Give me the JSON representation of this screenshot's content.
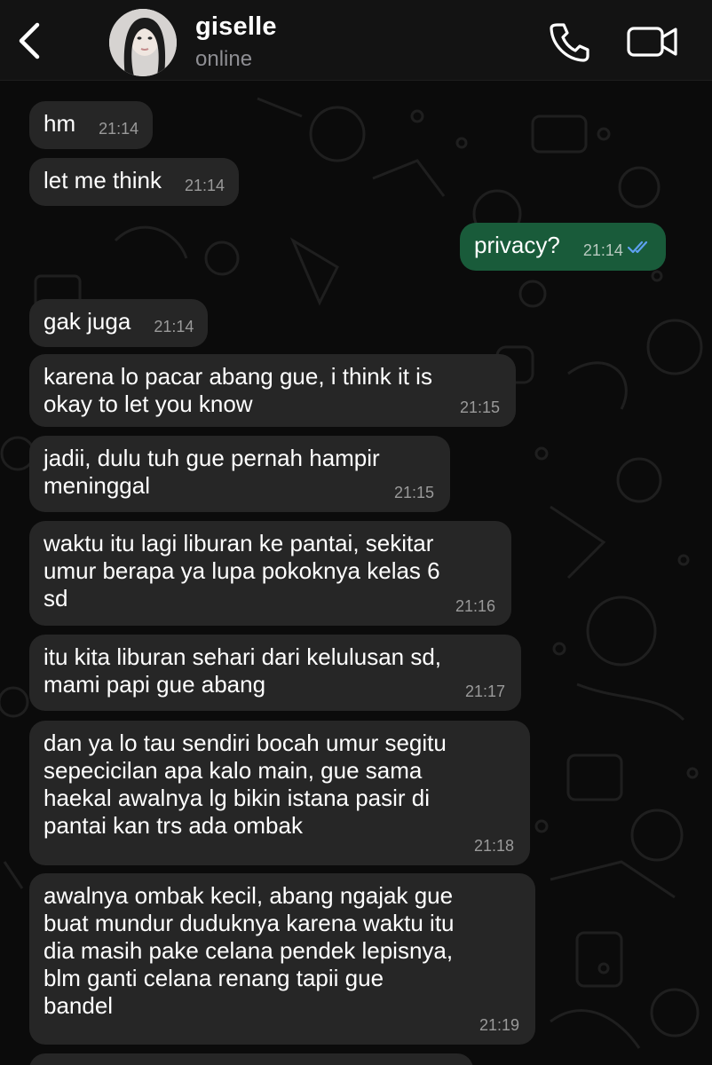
{
  "header": {
    "contact_name": "giselle",
    "status": "online",
    "back_icon": "chevron-left-icon",
    "call_icon": "phone-icon",
    "video_icon": "video-camera-icon"
  },
  "colors": {
    "incoming_bubble": "#262626",
    "outgoing_bubble": "#195b3a",
    "background": "#0b0b0b",
    "read_ticks": "#5ea1f0"
  },
  "messages": [
    {
      "direction": "incoming",
      "text": "hm",
      "time": "21:14"
    },
    {
      "direction": "incoming",
      "text": "let me think",
      "time": "21:14"
    },
    {
      "direction": "outgoing",
      "text": "privacy?",
      "time": "21:14",
      "status": "read"
    },
    {
      "direction": "incoming",
      "text": "gak juga",
      "time": "21:14"
    },
    {
      "direction": "incoming",
      "text": "karena lo pacar abang gue, i think it is\nokay to let you know",
      "time": "21:15"
    },
    {
      "direction": "incoming",
      "text": "jadii, dulu tuh gue pernah hampir\nmeninggal",
      "time": "21:15"
    },
    {
      "direction": "incoming",
      "text": "waktu itu lagi liburan ke pantai, sekitar\numur berapa ya lupa pokoknya kelas 6\nsd",
      "time": "21:16"
    },
    {
      "direction": "incoming",
      "text": "itu kita liburan sehari dari kelulusan sd,\nmami papi gue abang",
      "time": "21:17"
    },
    {
      "direction": "incoming",
      "text": "dan ya lo tau sendiri bocah umur segitu\nsepecicilan apa kalo main, gue sama\nhaekal awalnya lg bikin istana pasir di\npantai kan trs ada ombak",
      "time": "21:18"
    },
    {
      "direction": "incoming",
      "text": "awalnya ombak kecil, abang ngajak gue\nbuat mundur duduknya karena waktu itu\ndia masih pake celana pendek lepisnya,\nblm ganti celana renang tapii gue\nbandel",
      "time": "21:19"
    }
  ]
}
